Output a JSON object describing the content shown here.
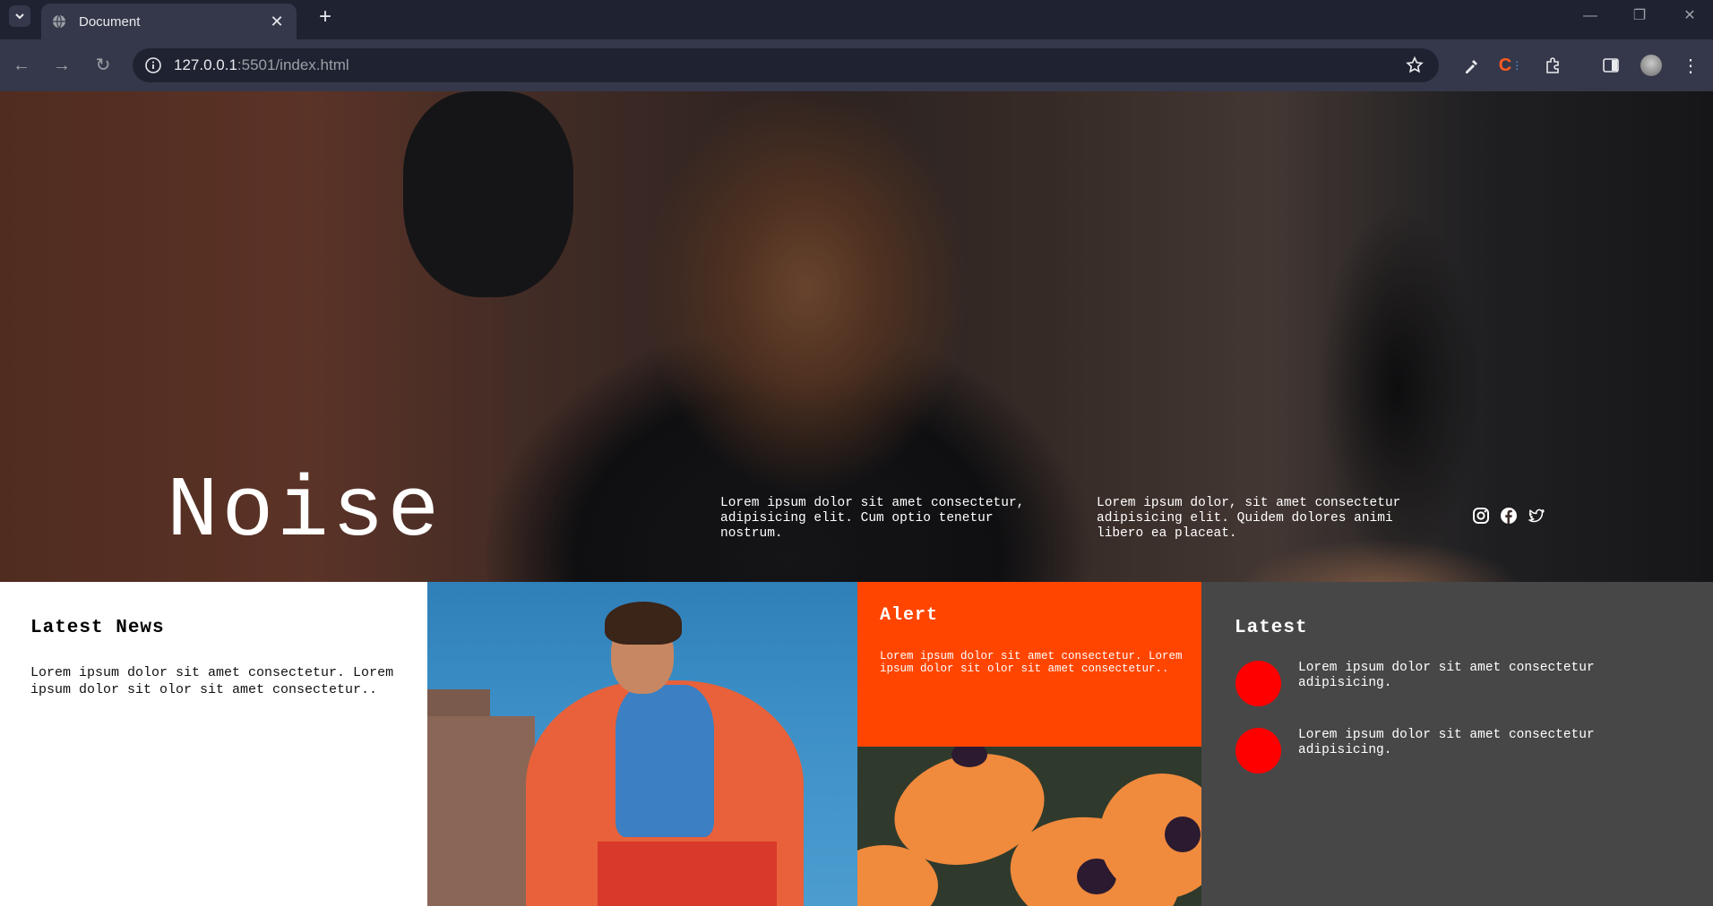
{
  "browser": {
    "tab_title": "Document",
    "url_host": "127.0.0.1",
    "url_rest": ":5501/index.html"
  },
  "hero": {
    "title": "Noise",
    "text1": "Lorem ipsum dolor sit amet consectetur, adipisicing elit. Cum optio tenetur nostrum.",
    "text2": "Lorem ipsum dolor, sit amet consectetur adipisicing elit. Quidem dolores animi libero ea placeat.",
    "social_icons": [
      "instagram-icon",
      "facebook-icon",
      "twitter-icon"
    ]
  },
  "news": {
    "heading": "Latest News",
    "body": "Lorem ipsum dolor sit amet consectetur. Lorem ipsum dolor sit olor sit amet consectetur.."
  },
  "alert": {
    "heading": "Alert",
    "body": "Lorem ipsum dolor sit amet consectetur. Lorem ipsum dolor sit olor sit amet consectetur..",
    "color": "#ff4500"
  },
  "latest": {
    "heading": "Latest",
    "items": [
      {
        "text": "Lorem ipsum dolor sit amet consectetur adipisicing."
      },
      {
        "text": "Lorem ipsum dolor sit amet consectetur adipisicing."
      }
    ],
    "dot_color": "#ff0000",
    "bg_color": "#474747"
  }
}
